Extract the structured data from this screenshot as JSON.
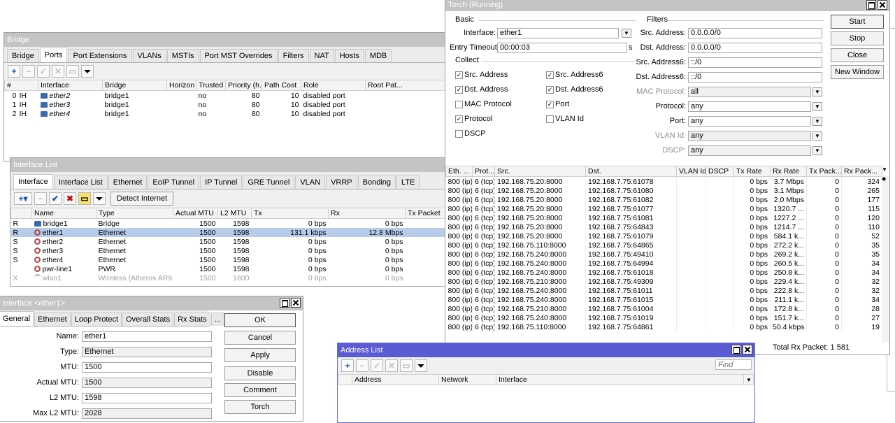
{
  "bridge": {
    "title": "Bridge",
    "tabs": [
      "Bridge",
      "Ports",
      "Port Extensions",
      "VLANs",
      "MSTIs",
      "Port MST Overrides",
      "Filters",
      "NAT",
      "Hosts",
      "MDB"
    ],
    "columns": [
      "#",
      "Interface",
      "Bridge",
      "Horizon",
      "Trusted",
      "Priority (h...",
      "Path Cost",
      "Role",
      "Root Pat..."
    ],
    "rows": [
      {
        "num": "0",
        "flags": "IH",
        "iface": "ether2",
        "bridge": "bridge1",
        "horizon": "",
        "trusted": "no",
        "priority": "80",
        "cost": "10",
        "role": "disabled port"
      },
      {
        "num": "1",
        "flags": "IH",
        "iface": "ether3",
        "bridge": "bridge1",
        "horizon": "",
        "trusted": "no",
        "priority": "80",
        "cost": "10",
        "role": "disabled port"
      },
      {
        "num": "2",
        "flags": "IH",
        "iface": "ether4",
        "bridge": "bridge1",
        "horizon": "",
        "trusted": "no",
        "priority": "80",
        "cost": "10",
        "role": "disabled port"
      }
    ]
  },
  "iflist": {
    "title": "Interface List",
    "tabs": [
      "Interface",
      "Interface List",
      "Ethernet",
      "EoIP Tunnel",
      "IP Tunnel",
      "GRE Tunnel",
      "VLAN",
      "VRRP",
      "Bonding",
      "LTE"
    ],
    "detect_label": "Detect Internet",
    "columns": [
      "Name",
      "Type",
      "Actual MTU",
      "L2 MTU",
      "Tx",
      "Rx",
      "Tx Packet"
    ],
    "rows": [
      {
        "flag": "R",
        "name": "bridge1",
        "type": "Bridge",
        "mtu": "1500",
        "l2": "1598",
        "tx": "0 bps",
        "rx": "0 bps",
        "icon": "bridge",
        "state": ""
      },
      {
        "flag": "R",
        "name": "ether1",
        "type": "Ethernet",
        "mtu": "1500",
        "l2": "1598",
        "tx": "131.1 kbps",
        "rx": "12.8 Mbps",
        "icon": "eth",
        "state": "sel"
      },
      {
        "flag": "S",
        "name": "ether2",
        "type": "Ethernet",
        "mtu": "1500",
        "l2": "1598",
        "tx": "0 bps",
        "rx": "0 bps",
        "icon": "eth",
        "state": ""
      },
      {
        "flag": "S",
        "name": "ether3",
        "type": "Ethernet",
        "mtu": "1500",
        "l2": "1598",
        "tx": "0 bps",
        "rx": "0 bps",
        "icon": "eth",
        "state": ""
      },
      {
        "flag": "S",
        "name": "ether4",
        "type": "Ethernet",
        "mtu": "1500",
        "l2": "1598",
        "tx": "0 bps",
        "rx": "0 bps",
        "icon": "eth",
        "state": ""
      },
      {
        "flag": "",
        "name": "pwr-line1",
        "type": "PWR",
        "mtu": "1500",
        "l2": "1598",
        "tx": "0 bps",
        "rx": "0 bps",
        "icon": "eth",
        "state": ""
      },
      {
        "flag": "X",
        "name": "wlan1",
        "type": "Wireless (Atheros AR9...",
        "mtu": "1500",
        "l2": "1600",
        "tx": "0 bps",
        "rx": "0 bps",
        "icon": "wlan",
        "state": "dis"
      }
    ]
  },
  "ifdlg": {
    "title": "Interface <ether1>",
    "tabs": [
      "General",
      "Ethernet",
      "Loop Protect",
      "Overall Stats",
      "Rx Stats",
      "..."
    ],
    "fields": [
      {
        "label": "Name:",
        "value": "ether1",
        "gray": false
      },
      {
        "label": "Type:",
        "value": "Ethernet",
        "gray": true
      },
      {
        "label": "MTU:",
        "value": "1500",
        "gray": false
      },
      {
        "label": "Actual MTU:",
        "value": "1500",
        "gray": true
      },
      {
        "label": "L2 MTU:",
        "value": "1598",
        "gray": false
      },
      {
        "label": "Max L2 MTU:",
        "value": "2028",
        "gray": true
      }
    ],
    "buttons": [
      "OK",
      "Cancel",
      "Apply",
      "Disable",
      "Comment",
      "Torch"
    ]
  },
  "torch": {
    "title": "Torch (Running)",
    "basic_label": "Basic",
    "interface_label": "Interface:",
    "interface_value": "ether1",
    "timeout_label": "Entry Timeout:",
    "timeout_value": "00:00:03",
    "timeout_unit": "s",
    "collect_label": "Collect",
    "collect": [
      {
        "label": "Src. Address",
        "checked": true
      },
      {
        "label": "Src. Address6",
        "checked": true
      },
      {
        "label": "Dst. Address",
        "checked": true
      },
      {
        "label": "Dst. Address6",
        "checked": true
      },
      {
        "label": "MAC Protocol",
        "checked": false
      },
      {
        "label": "Port",
        "checked": true
      },
      {
        "label": "Protocol",
        "checked": true
      },
      {
        "label": "VLAN Id",
        "checked": false
      },
      {
        "label": "DSCP",
        "checked": false
      }
    ],
    "filters_label": "Filters",
    "filters": [
      {
        "label": "Src. Address:",
        "value": "0.0.0.0/0",
        "dd": false,
        "gray": false
      },
      {
        "label": "Dst. Address:",
        "value": "0.0.0.0/0",
        "dd": false,
        "gray": false
      },
      {
        "label": "Src. Address6:",
        "value": "::/0",
        "dd": false,
        "gray": false
      },
      {
        "label": "Dst. Address6:",
        "value": "::/0",
        "dd": false,
        "gray": false
      },
      {
        "label": "MAC Protocol:",
        "value": "all",
        "dd": true,
        "gray": true
      },
      {
        "label": "Protocol:",
        "value": "any",
        "dd": true,
        "gray": false
      },
      {
        "label": "Port:",
        "value": "any",
        "dd": true,
        "gray": false
      },
      {
        "label": "VLAN Id:",
        "value": "any",
        "dd": true,
        "gray": true
      },
      {
        "label": "DSCP:",
        "value": "any",
        "dd": true,
        "gray": true
      }
    ],
    "buttons": [
      "Start",
      "Stop",
      "Close",
      "New Window"
    ],
    "columns": [
      "Eth. ...",
      "Prot...",
      "Src.",
      "Dst.",
      "VLAN Id",
      "DSCP",
      "Tx Rate",
      "Rx Rate",
      "Tx Pack...",
      "Rx Pack..."
    ],
    "rows": [
      [
        "800 (ip)",
        "6 (tcp)",
        "192.168.75.20:8000",
        "192.168.7.75:61078",
        "",
        "",
        "0 bps",
        "3.7 Mbps",
        "0",
        "324"
      ],
      [
        "800 (ip)",
        "6 (tcp)",
        "192.168.75.20:8000",
        "192.168.7.75:61080",
        "",
        "",
        "0 bps",
        "3.1 Mbps",
        "0",
        "265"
      ],
      [
        "800 (ip)",
        "6 (tcp)",
        "192.168.75.20:8000",
        "192.168.7.75:61082",
        "",
        "",
        "0 bps",
        "2.0 Mbps",
        "0",
        "177"
      ],
      [
        "800 (ip)",
        "6 (tcp)",
        "192.168.75.20:8000",
        "192.168.7.75:61077",
        "",
        "",
        "0 bps",
        "1320.7 ...",
        "0",
        "115"
      ],
      [
        "800 (ip)",
        "6 (tcp)",
        "192.168.75.20:8000",
        "192.168.7.75:61081",
        "",
        "",
        "0 bps",
        "1227.2 ...",
        "0",
        "120"
      ],
      [
        "800 (ip)",
        "6 (tcp)",
        "192.168.75.20:8000",
        "192.168.7.75:64843",
        "",
        "",
        "0 bps",
        "1214.7 ...",
        "0",
        "110"
      ],
      [
        "800 (ip)",
        "6 (tcp)",
        "192.168.75.20:8000",
        "192.168.7.75:61079",
        "",
        "",
        "0 bps",
        "584.1 k...",
        "0",
        "52"
      ],
      [
        "800 (ip)",
        "6 (tcp)",
        "192.168.75.110:8000",
        "192.168.7.75:64865",
        "",
        "",
        "0 bps",
        "272.2 k...",
        "0",
        "35"
      ],
      [
        "800 (ip)",
        "6 (tcp)",
        "192.168.75.240:8000",
        "192.168.7.75:49410",
        "",
        "",
        "0 bps",
        "269.2 k...",
        "0",
        "35"
      ],
      [
        "800 (ip)",
        "6 (tcp)",
        "192.168.75.240:8000",
        "192.168.7.75:64994",
        "",
        "",
        "0 bps",
        "260.5 k...",
        "0",
        "34"
      ],
      [
        "800 (ip)",
        "6 (tcp)",
        "192.168.75.240:8000",
        "192.168.7.75:61018",
        "",
        "",
        "0 bps",
        "250.8 k...",
        "0",
        "34"
      ],
      [
        "800 (ip)",
        "6 (tcp)",
        "192.168.75.210:8000",
        "192.168.7.75:49309",
        "",
        "",
        "0 bps",
        "229.4 k...",
        "0",
        "32"
      ],
      [
        "800 (ip)",
        "6 (tcp)",
        "192.168.75.240:8000",
        "192.168.7.75:61011",
        "",
        "",
        "0 bps",
        "222.8 k...",
        "0",
        "32"
      ],
      [
        "800 (ip)",
        "6 (tcp)",
        "192.168.75.240:8000",
        "192.168.7.75:61015",
        "",
        "",
        "0 bps",
        "211.1 k...",
        "0",
        "34"
      ],
      [
        "800 (ip)",
        "6 (tcp)",
        "192.168.75.210:8000",
        "192.168.7.75:61004",
        "",
        "",
        "0 bps",
        "172.8 k...",
        "0",
        "28"
      ],
      [
        "800 (ip)",
        "6 (tcp)",
        "192.168.75.240:8000",
        "192.168.7.75:61019",
        "",
        "",
        "0 bps",
        "151.7 k...",
        "0",
        "27"
      ],
      [
        "800 (ip)",
        "6 (tcp)",
        "192.168.75.110:8000",
        "192.168.7.75:64861",
        "",
        "",
        "0 bps",
        "50.4 kbps",
        "0",
        "19"
      ]
    ],
    "total": "Total Rx Packet: 1 581"
  },
  "addr": {
    "title": "Address List",
    "find_placeholder": "Find",
    "columns": [
      "Address",
      "Network",
      "Interface"
    ]
  },
  "colors": {
    "active_title": "#5b5bd6",
    "inactive_title": "#c4c4c4",
    "selected_row": "#b7cbeb"
  }
}
